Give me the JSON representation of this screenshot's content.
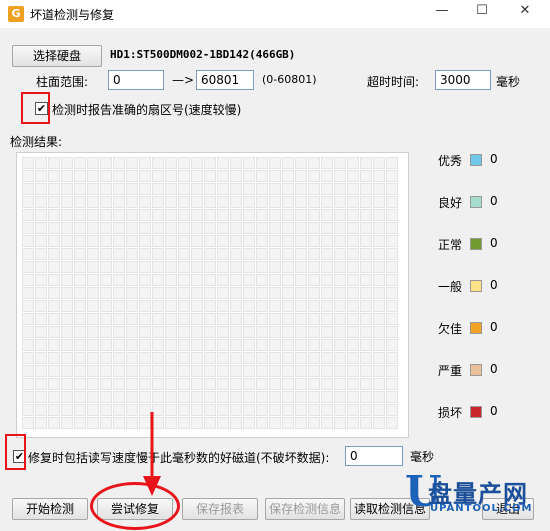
{
  "window": {
    "title": "坏道检测与修复",
    "minimize": "—",
    "maximize": "☐",
    "close": "✕"
  },
  "disk": {
    "select_button": "选择硬盘",
    "disk_label": "HD1:ST500DM002-1BD142(466GB)"
  },
  "range": {
    "label": "柱面范围:",
    "start": "0",
    "arrow": "—>",
    "end": "60801",
    "hint": "(0-60801)",
    "timeout_label": "超时时间:",
    "timeout_value": "3000",
    "timeout_unit": "毫秒"
  },
  "report_sector": {
    "checked": true,
    "label": "检测时报告准确的扇区号(速度较慢)"
  },
  "results": {
    "label": "检测结果:"
  },
  "legend": [
    {
      "label": "优秀",
      "color": "#6ec8ea",
      "count": "0"
    },
    {
      "label": "良好",
      "color": "#a6dccb",
      "count": "0"
    },
    {
      "label": "正常",
      "color": "#6e9a2e",
      "count": "0"
    },
    {
      "label": "一般",
      "color": "#ffe38a",
      "count": "0"
    },
    {
      "label": "欠佳",
      "color": "#f3a226",
      "count": "0"
    },
    {
      "label": "严重",
      "color": "#e8c09a",
      "count": "0"
    },
    {
      "label": "损坏",
      "color": "#c8282c",
      "count": "0"
    }
  ],
  "repair_option": {
    "checked": true,
    "label": "修复时包括读写速度慢于此毫秒数的好磁道(不破坏数据):",
    "value": "0",
    "unit": "毫秒"
  },
  "buttons": {
    "start": "开始检测",
    "repair": "尝试修复",
    "save_report": "保存报表",
    "save_info": "保存检测信息",
    "read_info": "读取检测信息",
    "exit": "退出"
  },
  "watermark": {
    "letter": "U",
    "brand": "盘量产网",
    "site": "UPANTOOL.COM"
  },
  "accent": {
    "highlight": "#e8141a"
  }
}
